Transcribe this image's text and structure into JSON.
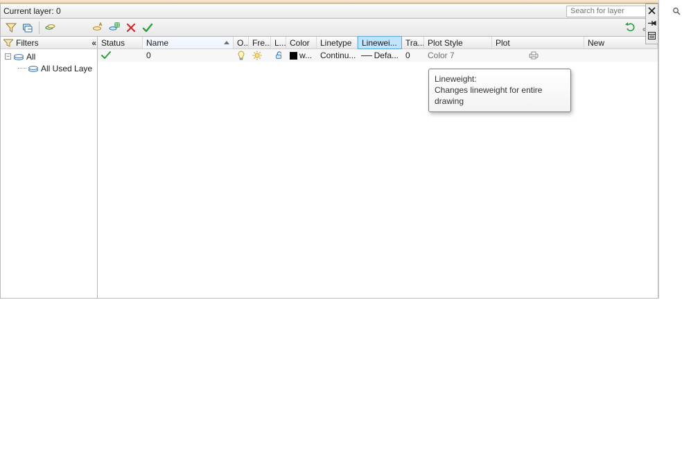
{
  "header": {
    "title": "Current layer: 0",
    "search_placeholder": "Search for layer"
  },
  "toolbar": {
    "icons": [
      "layer-filter-icon",
      "layer-states-icon",
      "layer-isolate-icon",
      "new-layer-icon",
      "delete-layer-icon",
      "cancel-icon",
      "apply-icon",
      "refresh-icon",
      "settings-icon"
    ]
  },
  "filters": {
    "header": "Filters",
    "collapse_glyph": "«",
    "tree": {
      "root": {
        "expand": "−",
        "label": "All"
      },
      "child": {
        "label": "All Used Laye"
      }
    }
  },
  "columns": {
    "status": "Status",
    "name": "Name",
    "on": "O..",
    "freeze": "Fre...",
    "lock": "L...",
    "color": "Color",
    "linetype": "Linetype",
    "lineweight": "Linewei...",
    "transparency": "Tra...",
    "plotstyle": "Plot Style",
    "plot": "Plot",
    "newvp": "New"
  },
  "row0": {
    "name": "0",
    "color_label": "w...",
    "linetype": "Continu...",
    "lineweight": "Defa...",
    "transparency": "0",
    "plotstyle": "Color 7"
  },
  "tooltip": {
    "title": "Lineweight:",
    "body": "Changes lineweight for entire drawing"
  },
  "sidebar": {
    "icons": [
      "close-icon",
      "pin-icon",
      "properties-icon"
    ]
  }
}
